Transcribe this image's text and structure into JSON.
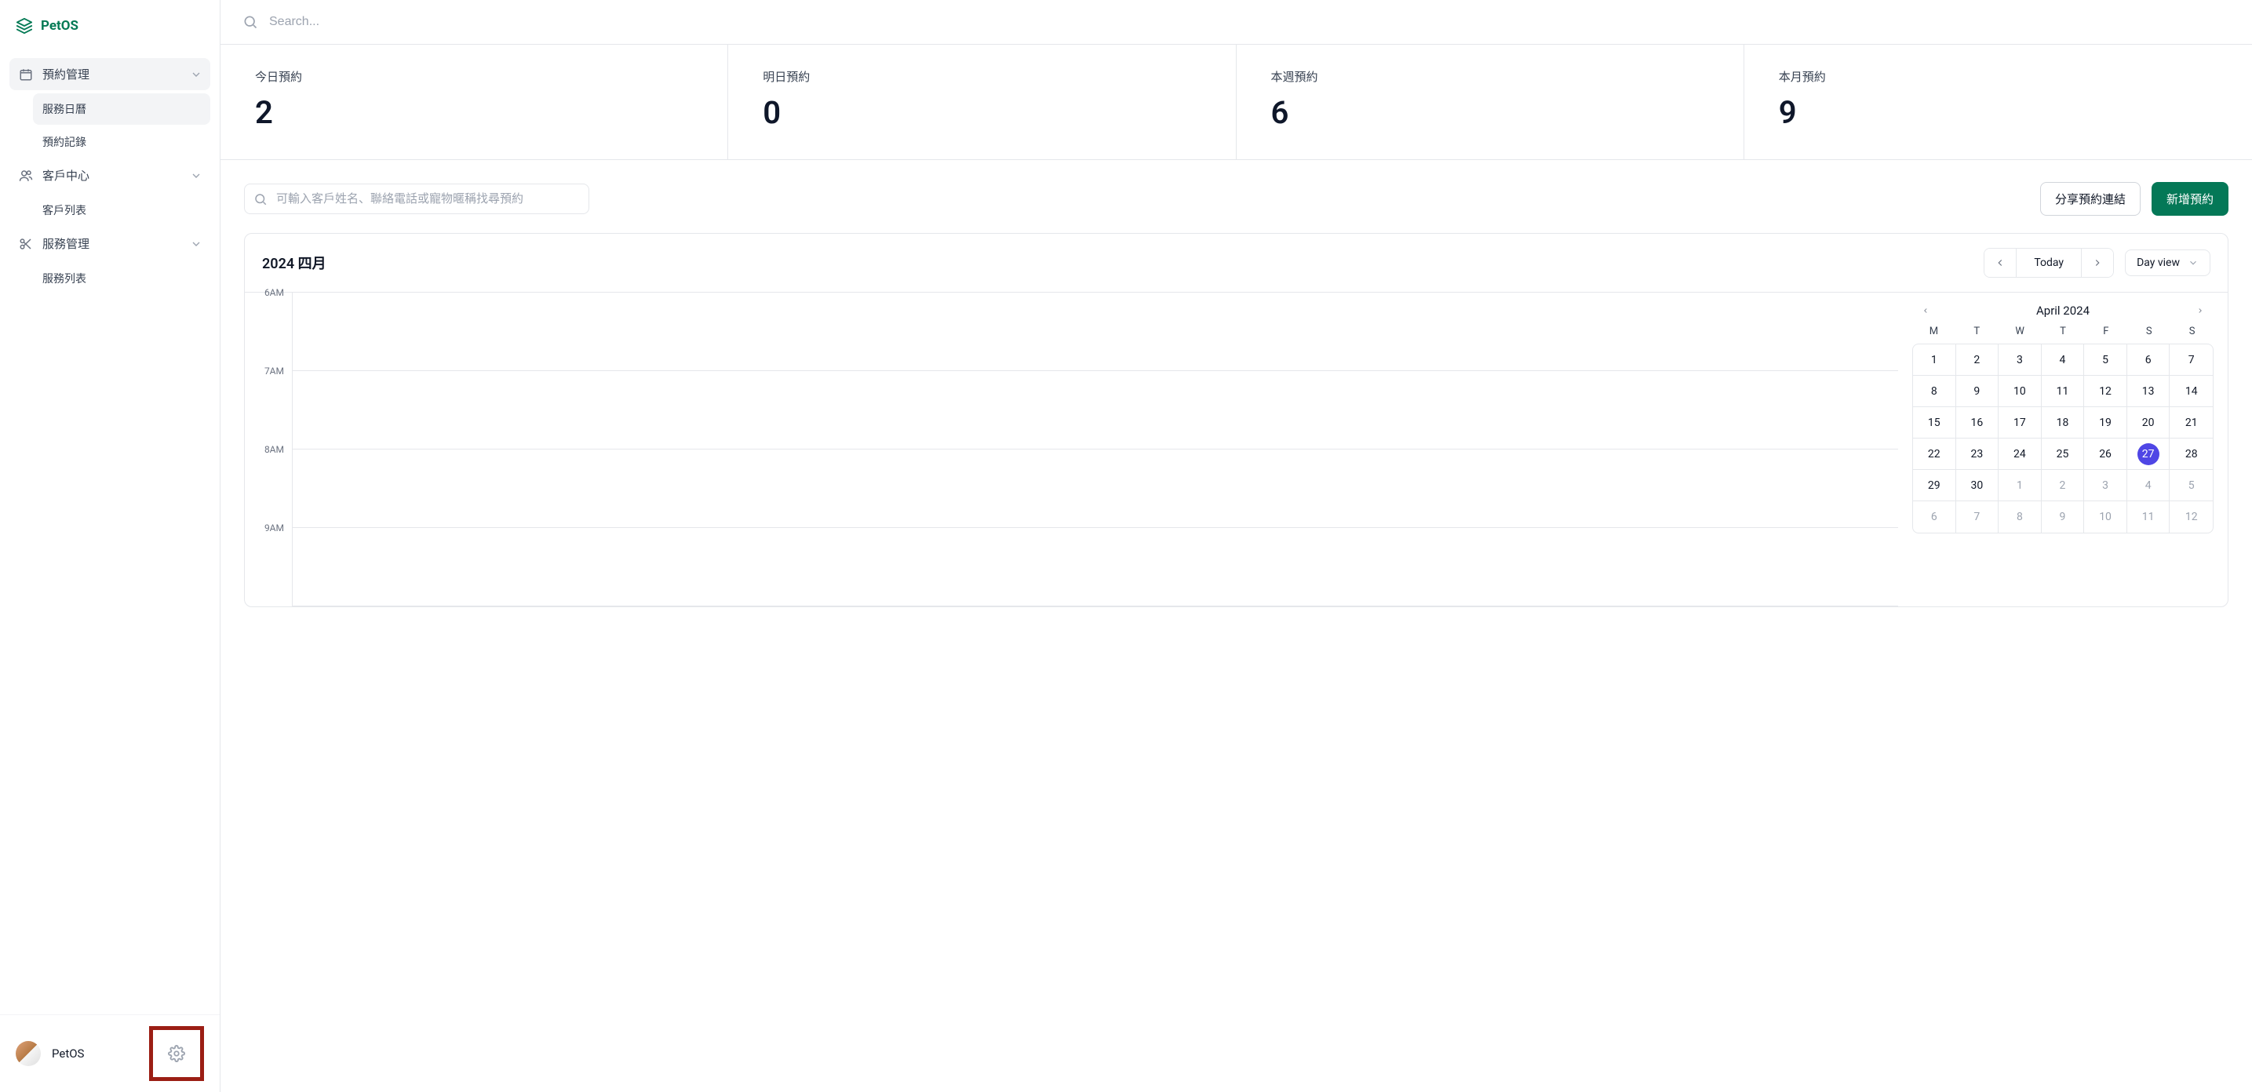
{
  "brand": {
    "name": "PetOS"
  },
  "search": {
    "placeholder": "Search..."
  },
  "sidebar": {
    "groups": [
      {
        "label": "預約管理",
        "children": [
          {
            "label": "服務日曆"
          },
          {
            "label": "預約記錄"
          }
        ]
      },
      {
        "label": "客戶中心",
        "children": [
          {
            "label": "客戶列表"
          }
        ]
      },
      {
        "label": "服務管理",
        "children": [
          {
            "label": "服務列表"
          }
        ]
      }
    ],
    "user": {
      "name": "PetOS"
    }
  },
  "stats": [
    {
      "label": "今日預約",
      "value": "2"
    },
    {
      "label": "明日預約",
      "value": "0"
    },
    {
      "label": "本週預約",
      "value": "6"
    },
    {
      "label": "本月預約",
      "value": "9"
    }
  ],
  "actions": {
    "filter_placeholder": "可輸入客戶姓名、聯絡電話或寵物暱稱找尋預約",
    "share_label": "分享預約連結",
    "new_label": "新增預約"
  },
  "panel": {
    "title": "2024 四月",
    "today_label": "Today",
    "view_label": "Day view",
    "hours": [
      "6AM",
      "7AM",
      "8AM",
      "9AM"
    ]
  },
  "mini_cal": {
    "title": "April 2024",
    "weekdays": [
      "M",
      "T",
      "W",
      "T",
      "F",
      "S",
      "S"
    ],
    "days": [
      {
        "n": 1
      },
      {
        "n": 2
      },
      {
        "n": 3
      },
      {
        "n": 4
      },
      {
        "n": 5
      },
      {
        "n": 6
      },
      {
        "n": 7
      },
      {
        "n": 8
      },
      {
        "n": 9
      },
      {
        "n": 10
      },
      {
        "n": 11
      },
      {
        "n": 12
      },
      {
        "n": 13
      },
      {
        "n": 14
      },
      {
        "n": 15
      },
      {
        "n": 16
      },
      {
        "n": 17
      },
      {
        "n": 18
      },
      {
        "n": 19
      },
      {
        "n": 20
      },
      {
        "n": 21
      },
      {
        "n": 22
      },
      {
        "n": 23
      },
      {
        "n": 24
      },
      {
        "n": 25
      },
      {
        "n": 26
      },
      {
        "n": 27,
        "today": true
      },
      {
        "n": 28
      },
      {
        "n": 29
      },
      {
        "n": 30
      },
      {
        "n": 1,
        "other": true
      },
      {
        "n": 2,
        "other": true
      },
      {
        "n": 3,
        "other": true
      },
      {
        "n": 4,
        "other": true
      },
      {
        "n": 5,
        "other": true
      },
      {
        "n": 6,
        "other": true
      },
      {
        "n": 7,
        "other": true
      },
      {
        "n": 8,
        "other": true
      },
      {
        "n": 9,
        "other": true
      },
      {
        "n": 10,
        "other": true
      },
      {
        "n": 11,
        "other": true
      },
      {
        "n": 12,
        "other": true
      }
    ]
  }
}
